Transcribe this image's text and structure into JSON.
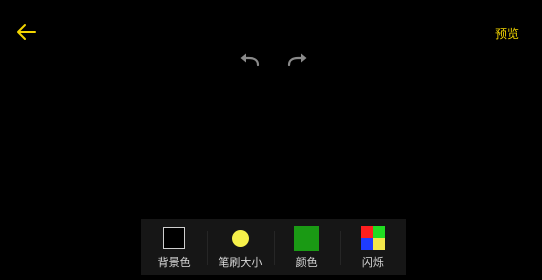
{
  "header": {
    "preview_label": "预览",
    "accent_color": "#f2d400"
  },
  "history": {
    "undo_icon": "undo-icon",
    "redo_icon": "redo-icon",
    "icon_color": "#8a8a8a"
  },
  "toolbar": {
    "background_label": "背景色",
    "brush_size_label": "笔刷大小",
    "color_label": "颜色",
    "flash_label": "闪烁",
    "background_color": "#000000",
    "brush_color": "#f6f04a",
    "selected_color": "#1a9a14",
    "flash_colors": [
      "#ff1f1f",
      "#21dd21",
      "#1e3cff",
      "#f2e64a"
    ]
  }
}
